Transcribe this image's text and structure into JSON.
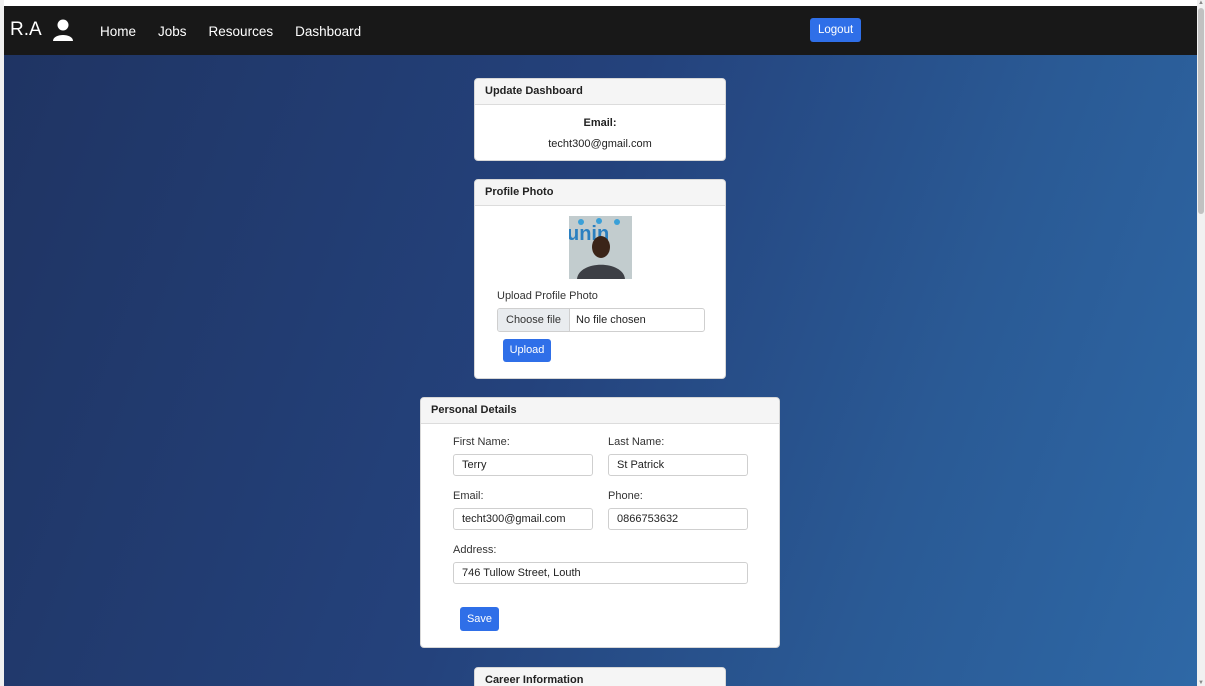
{
  "navbar": {
    "brand": "R.A",
    "links": [
      "Home",
      "Jobs",
      "Resources",
      "Dashboard"
    ],
    "logout_label": "Logout",
    "user_icon": "user-icon"
  },
  "update_dashboard": {
    "title": "Update Dashboard",
    "email_label": "Email:",
    "email_value": "techt300@gmail.com"
  },
  "profile_photo": {
    "title": "Profile Photo",
    "upload_label": "Upload Profile Photo",
    "choose_file_label": "Choose file",
    "file_status": "No file chosen",
    "upload_button": "Upload"
  },
  "personal_details": {
    "title": "Personal Details",
    "first_name_label": "First Name:",
    "first_name_value": "Terry",
    "last_name_label": "Last Name:",
    "last_name_value": "St Patrick",
    "email_label": "Email:",
    "email_value": "techt300@gmail.com",
    "phone_label": "Phone:",
    "phone_value": "0866753632",
    "address_label": "Address:",
    "address_value": "746 Tullow Street, Louth",
    "save_button": "Save"
  },
  "career_information": {
    "title": "Career Information"
  },
  "colors": {
    "navbar_bg": "#181818",
    "accent": "#2f6fe8",
    "background_gradient_start": "#1f3463",
    "background_gradient_end": "#2e68a6"
  }
}
